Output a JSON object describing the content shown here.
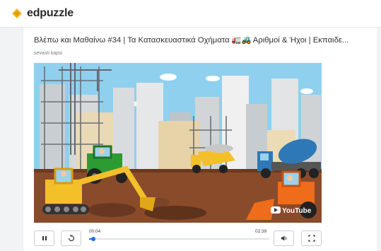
{
  "app": {
    "brand": "edpuzzle",
    "brand_color": "#f3b61f"
  },
  "video": {
    "title": "Βλέπω και Μαθαίνω #34 | Τα Κατασκευαστικά Οχήματα",
    "title_emojis": "🚛🚜",
    "title_suffix": "Αριθμοί & Ήχοι | Εκπαιδε...",
    "author": "sevasti kapsi",
    "watermark": "YouTube"
  },
  "player": {
    "current_time": "00:04",
    "duration": "02:39",
    "progress": 0.025,
    "accent": "#1b6fe8",
    "icons": [
      "pause-icon",
      "replay-icon",
      "volume-icon",
      "fullscreen-icon"
    ]
  }
}
